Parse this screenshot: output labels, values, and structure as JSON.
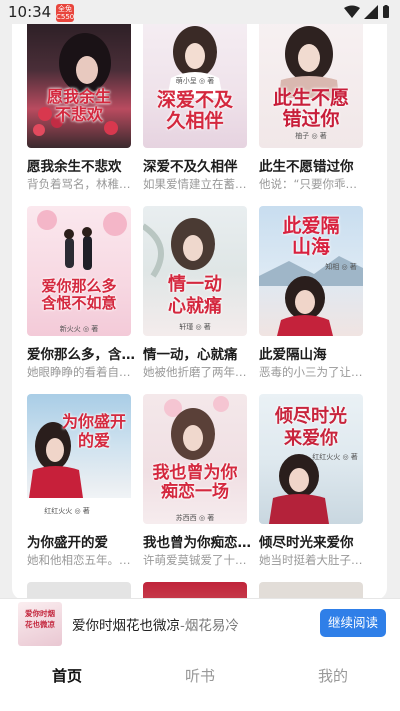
{
  "status_bar": {
    "time": "10:34",
    "badge": "全免 C550"
  },
  "books": [
    {
      "cover_title": "愿我余生不悲欢",
      "title": "愿我余生不悲欢",
      "desc": "背负着骂名，林稚…"
    },
    {
      "cover_title": "深爱不及久相伴",
      "cover_author": "萌小呈 ◎ 著",
      "title": "深爱不及久相伴",
      "desc": "如果爱情建立在蓄…"
    },
    {
      "cover_title": "此生不愿错过你",
      "cover_author": "柚子 ◎ 著",
      "title": "此生不愿错过你",
      "desc": "他说：“只要你乖乖…"
    },
    {
      "cover_title": "爱你那么多 含恨不如意",
      "cover_author": "新火火 ◎ 著",
      "title": "爱你那么多，含…",
      "desc": "她眼睁睁的看着自…"
    },
    {
      "cover_title": "情一动 心就痛",
      "cover_author": "轩瑾 ◎ 著",
      "title": "情一动，心就痛",
      "desc": "她被他折磨了两年…"
    },
    {
      "cover_title": "此爱隔山海",
      "cover_author": "知相 ◎ 著",
      "title": "此爱隔山海",
      "desc": "恶毒的小三为了让…"
    },
    {
      "cover_title": "为你盛开的爱",
      "cover_author": "红红火火 ◎ 著",
      "title": "为你盛开的爱",
      "desc": "她和他相恋五年。…"
    },
    {
      "cover_title": "我也曾为你痴恋一场",
      "cover_author": "苏西西 ◎ 著",
      "title": "我也曾为你痴恋…",
      "desc": "许萌爱莫铖爱了十…"
    },
    {
      "cover_title": "倾尽时光来爱你",
      "cover_author": "红红火火 ◎ 著",
      "title": "倾尽时光来爱你",
      "desc": "她当时挺着大肚子…"
    }
  ],
  "continue_reading": {
    "cover_title": "爱你时烟花也微凉",
    "book_title": "爱你时烟花也微凉",
    "author": "-烟花易冷",
    "button": "继续阅读"
  },
  "tabs": [
    {
      "label": "首页",
      "active": true
    },
    {
      "label": "听书",
      "active": false
    },
    {
      "label": "我的",
      "active": false
    }
  ],
  "colors": {
    "accent": "#2f7fe8",
    "cover_title_red": "#d4283e"
  }
}
